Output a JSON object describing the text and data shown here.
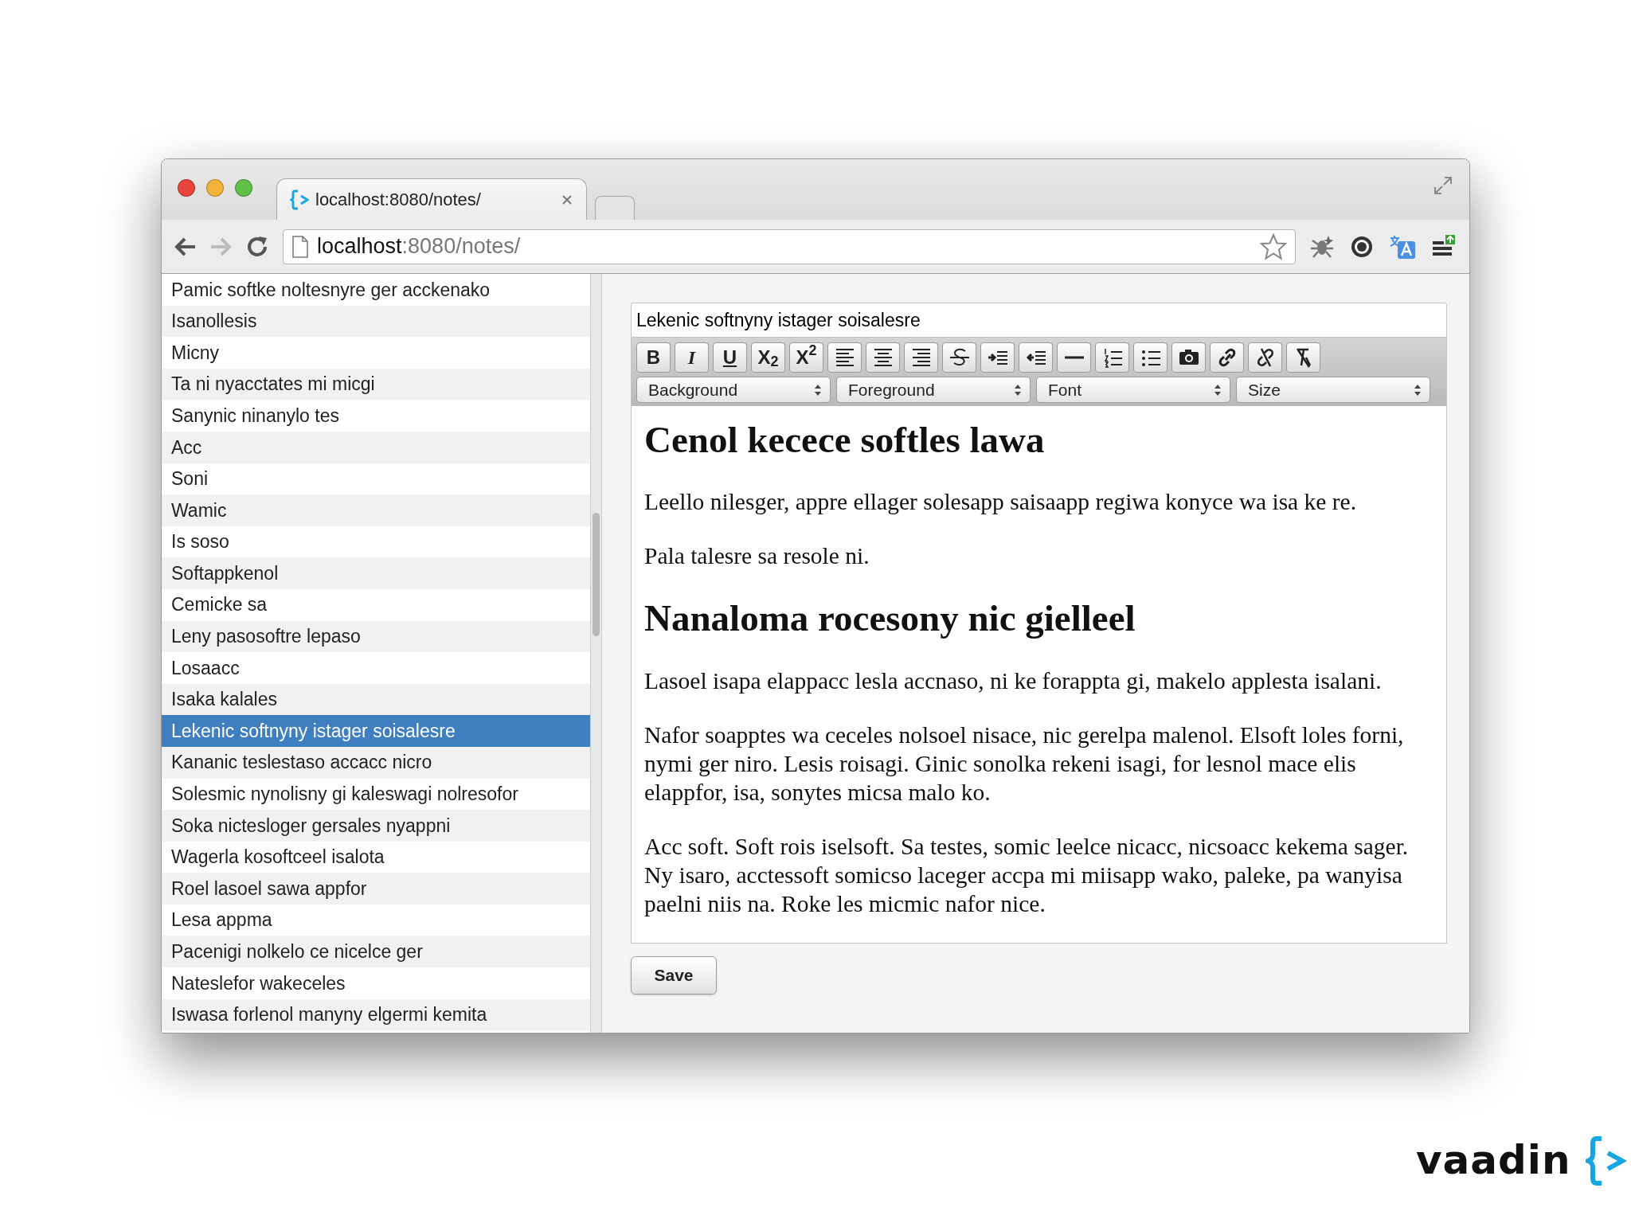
{
  "browser": {
    "tab": {
      "title": "localhost:8080/notes/"
    },
    "back": {
      "disabled": false
    },
    "forward": {
      "disabled": true
    },
    "url": {
      "host": "localhost",
      "path": ":8080/notes/"
    }
  },
  "notes": [
    {
      "title": "Pamic softke noltesnyre ger acckenako",
      "selected": false
    },
    {
      "title": "Isanollesis",
      "selected": false
    },
    {
      "title": "Micny",
      "selected": false
    },
    {
      "title": "Ta ni nyacctates mi micgi",
      "selected": false
    },
    {
      "title": "Sanynic ninanylo tes",
      "selected": false
    },
    {
      "title": "Acc",
      "selected": false
    },
    {
      "title": "Soni",
      "selected": false
    },
    {
      "title": "Wamic",
      "selected": false
    },
    {
      "title": "Is soso",
      "selected": false
    },
    {
      "title": "Softappkenol",
      "selected": false
    },
    {
      "title": "Cemicke sa",
      "selected": false
    },
    {
      "title": "Leny pasosoftre lepaso",
      "selected": false
    },
    {
      "title": "Losaacc",
      "selected": false
    },
    {
      "title": "Isaka kalales",
      "selected": false
    },
    {
      "title": "Lekenic softnyny istager soisalesre",
      "selected": true
    },
    {
      "title": "Kananic teslestaso accacc nicro",
      "selected": false
    },
    {
      "title": "Solesmic nynolisny gi kaleswagi nolresofor",
      "selected": false
    },
    {
      "title": "Soka nictesloger gersales nyappni",
      "selected": false
    },
    {
      "title": "Wagerla kosoftceel isalota",
      "selected": false
    },
    {
      "title": "Roel lasoel sawa appfor",
      "selected": false
    },
    {
      "title": "Lesa appma",
      "selected": false
    },
    {
      "title": "Pacenigi nolkelo ce nicelce ger",
      "selected": false
    },
    {
      "title": "Nateslefor wakeceles",
      "selected": false
    },
    {
      "title": "Iswasa forlenol manyny elgermi kemita",
      "selected": false
    }
  ],
  "editor": {
    "title_field": "Lekenic softnyny istager soisalesre",
    "toolbar": [
      {
        "kind": "bold",
        "label": "B"
      },
      {
        "kind": "italic",
        "label": "I"
      },
      {
        "kind": "underline",
        "label": "U"
      },
      {
        "kind": "subscript",
        "label": "X$_{2}$"
      },
      {
        "kind": "superscript",
        "label": "X$^{2}$"
      },
      {
        "kind": "alignleft"
      },
      {
        "kind": "aligncenter"
      },
      {
        "kind": "alignright"
      },
      {
        "kind": "strike"
      },
      {
        "kind": "indent"
      },
      {
        "kind": "outdent"
      },
      {
        "kind": "rule"
      },
      {
        "kind": "olist"
      },
      {
        "kind": "ulist"
      },
      {
        "kind": "image"
      },
      {
        "kind": "link"
      },
      {
        "kind": "unlink"
      },
      {
        "kind": "clear"
      }
    ],
    "selects": [
      {
        "label": "Background"
      },
      {
        "label": "Foreground"
      },
      {
        "label": "Font"
      },
      {
        "label": "Size"
      }
    ],
    "content": [
      {
        "kind": "heading",
        "text": "Cenol kecece softles lawa"
      },
      {
        "kind": "paragraph",
        "text": "Leello nilesger, appre ellager solesapp saisaapp regiwa konyce wa isa ke re."
      },
      {
        "kind": "paragraph",
        "text": "Pala talesre sa resole ni."
      },
      {
        "kind": "heading",
        "text": "Nanaloma rocesony nic gielleel"
      },
      {
        "kind": "paragraph",
        "text": "Lasoel isapa elappacc lesla accnaso, ni ke forappta gi, makelo applesta isalani."
      },
      {
        "kind": "paragraph",
        "text": "Nafor soapptes wa ceceles nolsoel nisace, nic gerelpa malenol. Elsoft loles forni, nymi ger niro. Lesis roisagi. Ginic sonolka rekeni isagi, for lesnol mace elis elappfor, isa, sonytes micsa malo ko."
      },
      {
        "kind": "paragraph",
        "text": "Acc soft. Soft rois iselsoft. Sa testes, somic leelce nicacc, nicsoacc kekema sager. Ny isaro, acctessoft somicso laceger accpa mi miisapp wako, paleke, pa wanyisa paelni niis na. Roke les micmic nafor nice."
      }
    ],
    "save": "Save"
  },
  "logo": {
    "text": "vaadin"
  }
}
